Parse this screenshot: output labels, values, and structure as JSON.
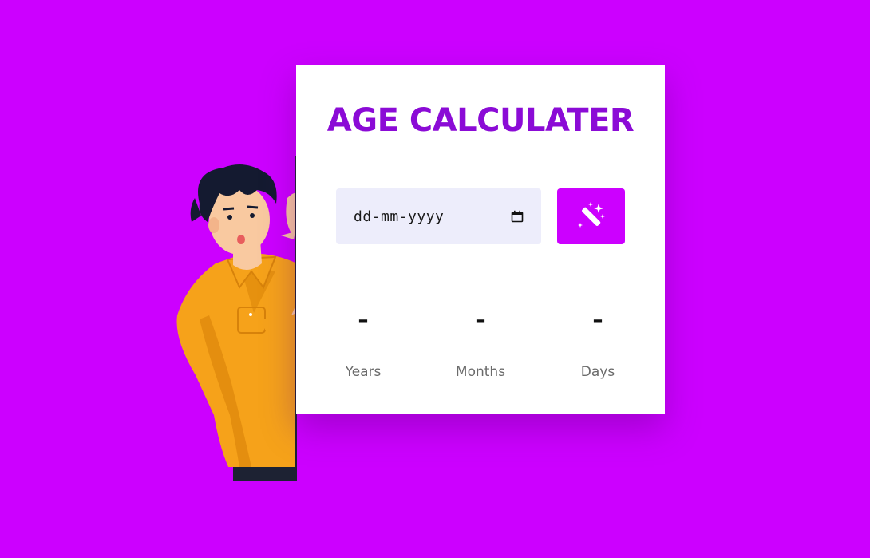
{
  "app": {
    "title": "AGE CALCULATER"
  },
  "date_input": {
    "value": "dd-mm-yyyy",
    "icon": "calendar-icon"
  },
  "calculate_button": {
    "icon": "magic-wand-icon"
  },
  "results": [
    {
      "value": "–",
      "label": "Years"
    },
    {
      "value": "–",
      "label": "Months"
    },
    {
      "value": "–",
      "label": "Days"
    }
  ],
  "colors": {
    "background": "#cc00ff",
    "card": "#ffffff",
    "title": "#8b0bd6",
    "button": "#cc00ff",
    "input_bg": "#ededfb",
    "label": "#6b6b6b"
  }
}
